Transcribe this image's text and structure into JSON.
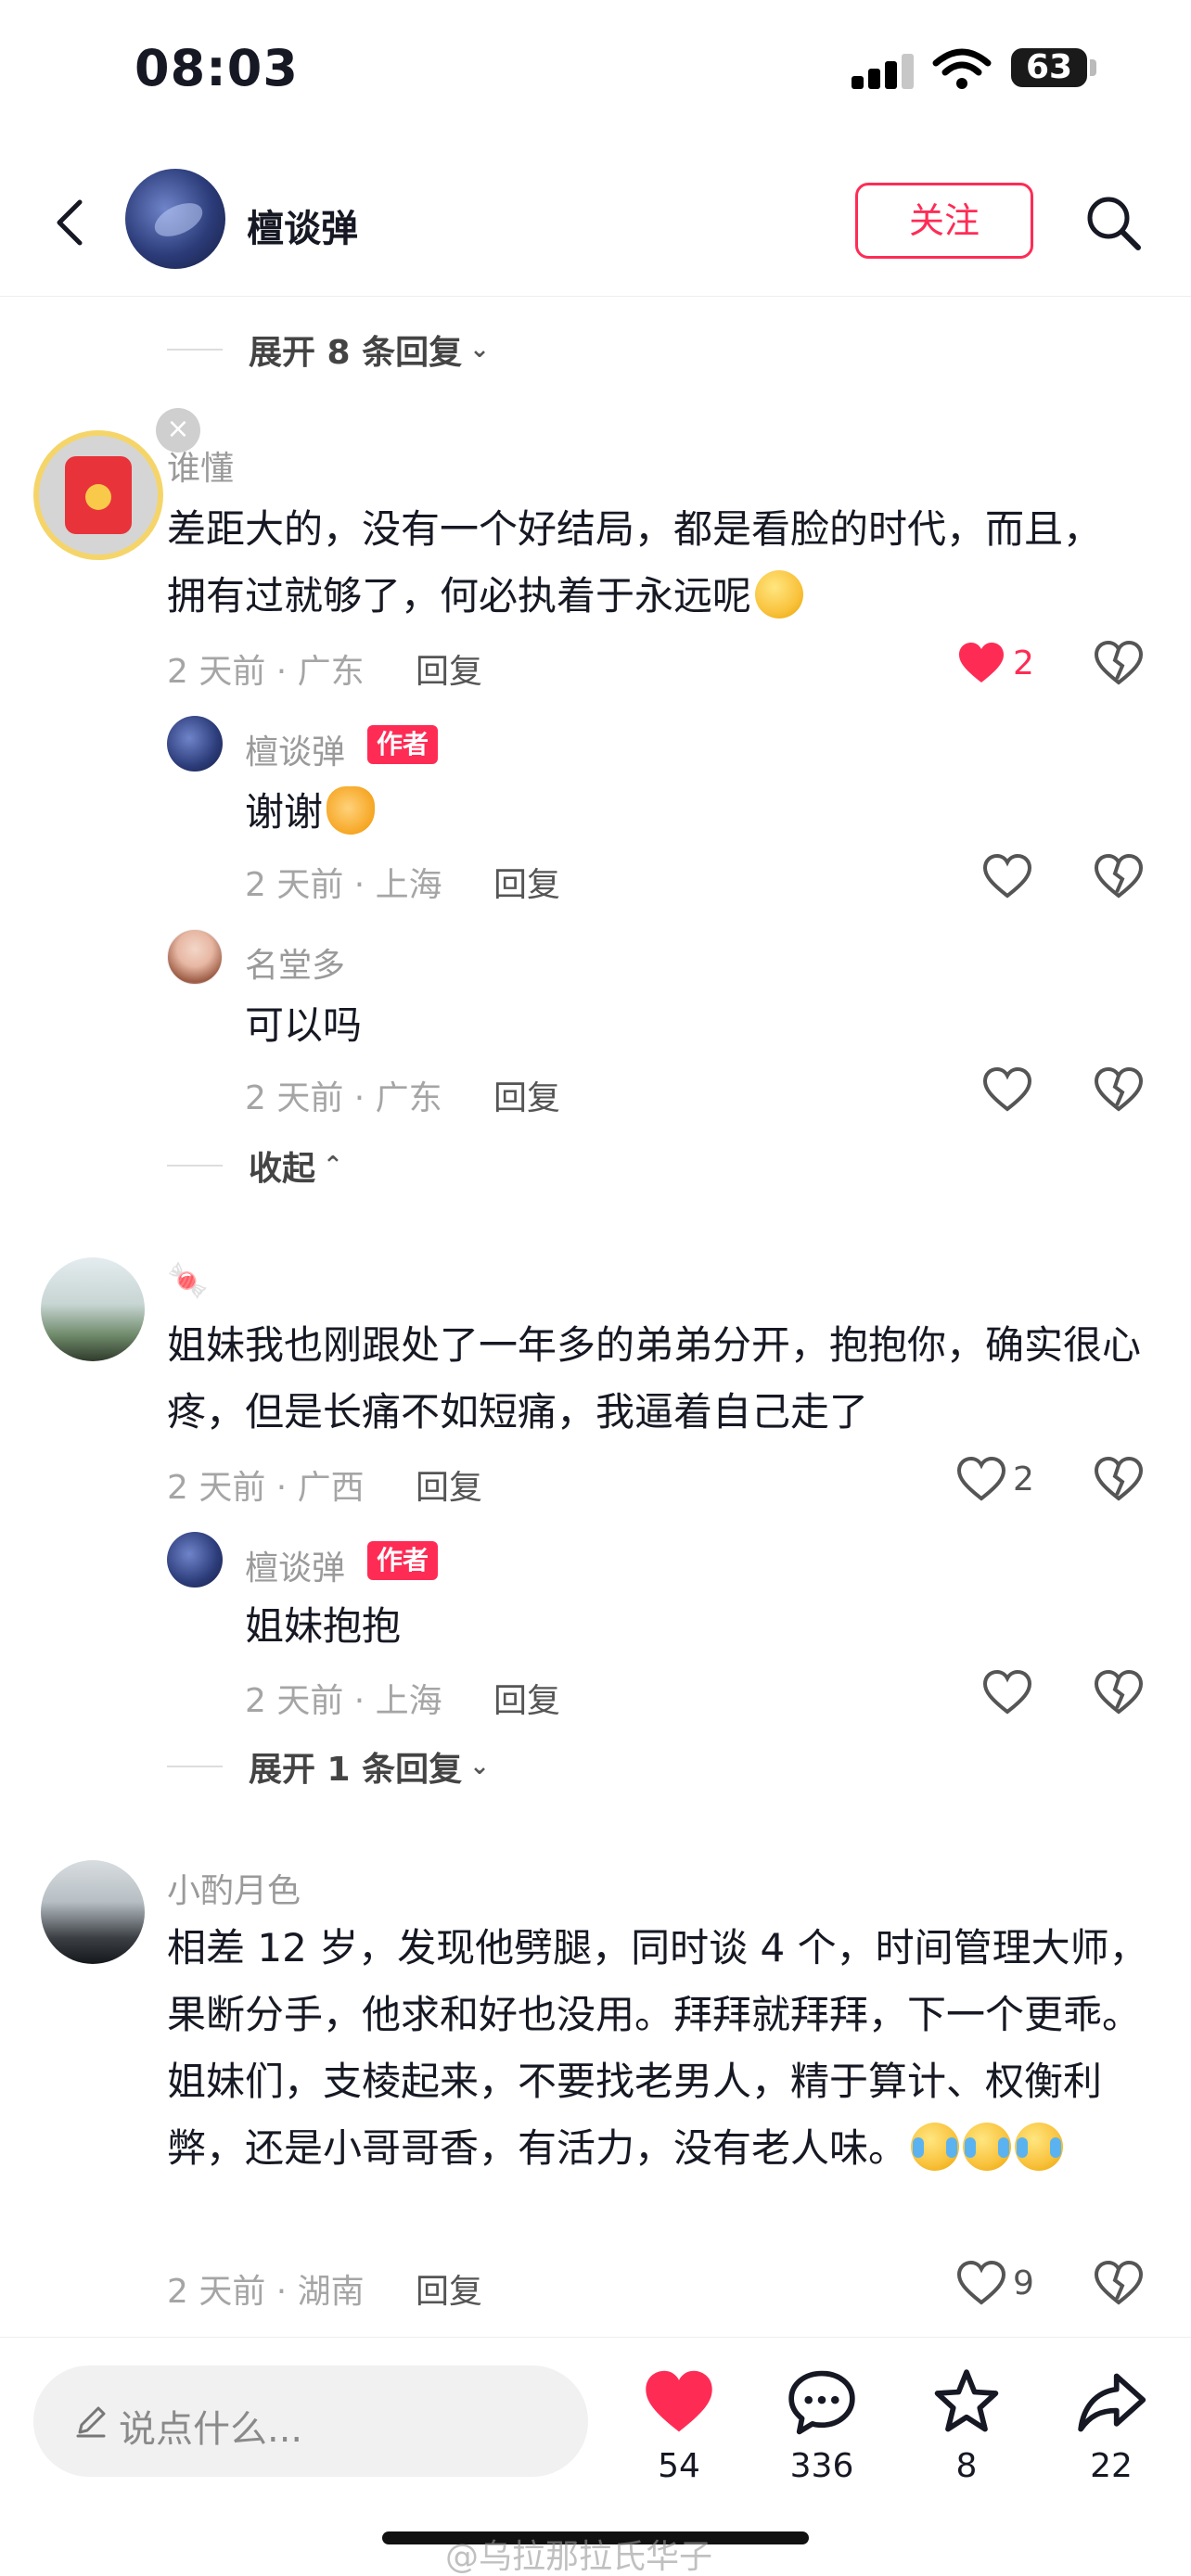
{
  "status_bar": {
    "time": "08:03",
    "battery": "63"
  },
  "header": {
    "username": "檀谈弹",
    "follow_label": "关注"
  },
  "thread1": {
    "expand_label": "展开 8 条回复",
    "comment": {
      "user": "谁懂",
      "text": "差距大的，没有一个好结局，都是看脸的时代，而且，拥有过就够了，何必执着于永远呢",
      "time_location": "2 天前 · 广东",
      "reply_label": "回复",
      "likes": "2"
    },
    "replies": [
      {
        "user": "檀谈弹",
        "tag": "作者",
        "text": "谢谢",
        "time_location": "2 天前 · 上海",
        "reply_label": "回复"
      },
      {
        "user": "名堂多",
        "text": "可以吗",
        "time_location": "2 天前 · 广东",
        "reply_label": "回复"
      }
    ],
    "collapse_label": "收起"
  },
  "thread2": {
    "comment": {
      "user": "🍬",
      "text": "姐妹我也刚跟处了一年多的弟弟分开，抱抱你，确实很心疼，但是长痛不如短痛，我逼着自己走了",
      "time_location": "2 天前 · 广西",
      "reply_label": "回复",
      "likes": "2"
    },
    "replies": [
      {
        "user": "檀谈弹",
        "tag": "作者",
        "text": "姐妹抱抱",
        "time_location": "2 天前 · 上海",
        "reply_label": "回复"
      }
    ],
    "expand_label": "展开 1 条回复"
  },
  "thread3": {
    "comment": {
      "user": "小酌月色",
      "text": "相差 12 岁，发现他劈腿，同时谈 4 个，时间管理大师，果断分手，他求和好也没用。拜拜就拜拜，下一个更乖。姐妹们，支棱起来，不要找老男人，精于算计、权衡利弊，还是小哥哥香，有活力，没有老人味。",
      "time_location": "2 天前 · 湖南",
      "reply_label": "回复",
      "likes": "9"
    }
  },
  "bottom_bar": {
    "input_placeholder": "说点什么...",
    "like_count": "54",
    "comment_count": "336",
    "favorite_count": "8",
    "share_count": "22"
  },
  "watermark": "@乌拉那拉氏华子",
  "colors": {
    "accent": "#fe2c55",
    "text": "#161823",
    "muted": "#a5a5a5"
  }
}
